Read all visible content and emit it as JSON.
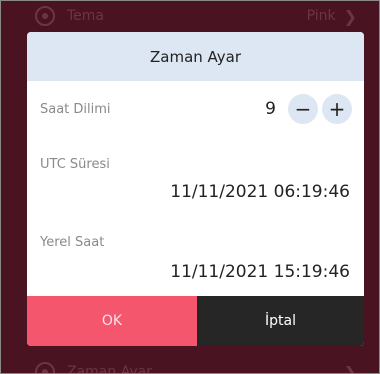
{
  "background": {
    "top_row": {
      "label": "Tema",
      "value": "Pink"
    },
    "bottom_row": {
      "label": "Zaman Ayar"
    }
  },
  "dialog": {
    "title": "Zaman Ayar",
    "timezone": {
      "label": "Saat Dilimi",
      "value": "9",
      "decrement": "−",
      "increment": "+"
    },
    "utc": {
      "label": "UTC Süresi",
      "value": "11/11/2021 06:19:46"
    },
    "local": {
      "label": "Yerel Saat",
      "value": "11/11/2021 15:19:46"
    },
    "ok_label": "OK",
    "cancel_label": "İptal"
  },
  "colors": {
    "backdrop": "#4a1322",
    "header": "#dde7f3",
    "ok": "#f4566d",
    "cancel": "#262626"
  }
}
